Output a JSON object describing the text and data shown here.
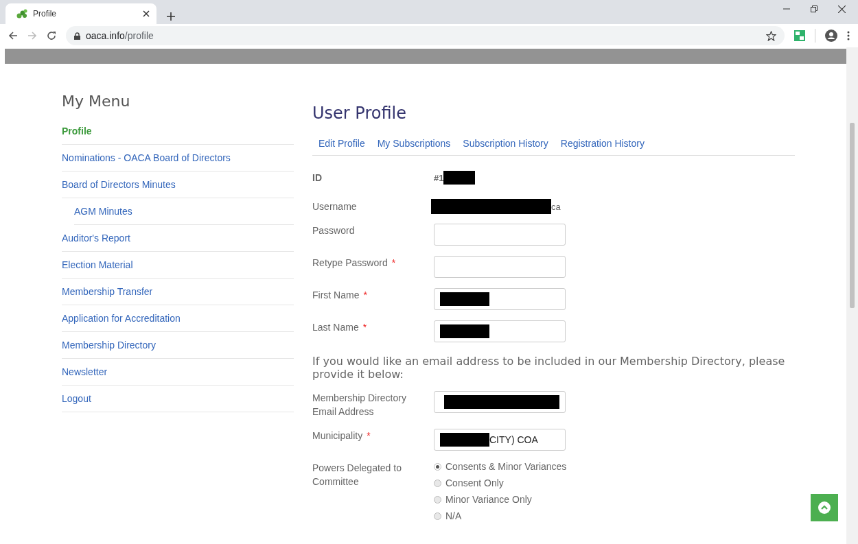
{
  "browser": {
    "tab_title": "Profile",
    "url_host": "oaca.info",
    "url_path": "/profile"
  },
  "sidebar": {
    "title": "My Menu",
    "items": [
      {
        "label": "Profile",
        "selected": true
      },
      {
        "label": "Nominations - OACA Board of Directors",
        "selected": false
      },
      {
        "label": "Board of Directors Minutes",
        "selected": false,
        "children": [
          {
            "label": "AGM Minutes",
            "selected": false
          }
        ]
      },
      {
        "label": "Auditor's Report",
        "selected": false
      },
      {
        "label": "Election Material",
        "selected": false
      },
      {
        "label": "Membership Transfer",
        "selected": false
      },
      {
        "label": "Application for Accreditation",
        "selected": false
      },
      {
        "label": "Membership Directory",
        "selected": false
      },
      {
        "label": "Newsletter",
        "selected": false
      },
      {
        "label": "Logout",
        "selected": false
      }
    ]
  },
  "main": {
    "title": "User Profile",
    "tabs": [
      {
        "label": "Edit Profile"
      },
      {
        "label": "My Subscriptions"
      },
      {
        "label": "Subscription History"
      },
      {
        "label": "Registration History"
      }
    ],
    "fields": [
      {
        "kind": "static",
        "label": "ID",
        "bold": true,
        "value": "#1",
        "redacted_after": true
      },
      {
        "kind": "static",
        "label": "Username",
        "bold": false,
        "value": "ca",
        "redacted_before": true
      },
      {
        "kind": "input",
        "label": "Password"
      },
      {
        "kind": "input",
        "label": "Retype Password",
        "required_mark": "*"
      },
      {
        "kind": "input",
        "label": "First Name",
        "required_mark": "*",
        "redacted_before": true
      },
      {
        "kind": "input",
        "label": "Last Name",
        "required_mark": "*",
        "redacted_before": true
      },
      {
        "kind": "heading",
        "text": "If you would like an email address to be included in our Membership Directory, please provide it below:"
      },
      {
        "kind": "input",
        "label": "Membership Directory Email Address",
        "redacted_before": true
      },
      {
        "kind": "input",
        "label": "Municipality",
        "required_mark": "*",
        "value": "CITY) COA",
        "redacted_before": true
      },
      {
        "kind": "radio",
        "label": "Powers Delegated to Committee",
        "options": [
          {
            "label": "Consents & Minor Variances",
            "selected": true
          },
          {
            "label": "Consent Only",
            "selected": false
          },
          {
            "label": "Minor Variance Only",
            "selected": false
          },
          {
            "label": "N/A",
            "selected": false
          }
        ]
      }
    ]
  }
}
